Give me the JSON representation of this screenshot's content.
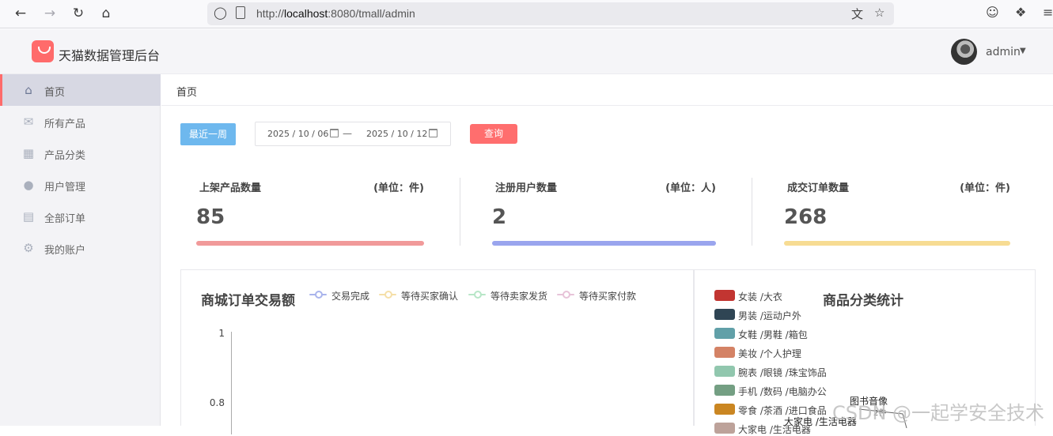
{
  "browser": {
    "url_prefix": "http://",
    "url_host": "localhost",
    "url_path": ":8080/tmall/admin"
  },
  "header": {
    "app_title": "天猫数据管理后台",
    "user_name": "admin"
  },
  "sidebar": {
    "items": [
      {
        "label": "首页",
        "icon": "home-icon",
        "active": true
      },
      {
        "label": "所有产品",
        "icon": "mail-icon",
        "active": false
      },
      {
        "label": "产品分类",
        "icon": "grid-icon",
        "active": false
      },
      {
        "label": "用户管理",
        "icon": "user-icon",
        "active": false
      },
      {
        "label": "全部订单",
        "icon": "clipboard-icon",
        "active": false
      },
      {
        "label": "我的账户",
        "icon": "gear-icon",
        "active": false
      }
    ]
  },
  "breadcrumb": "首页",
  "filters": {
    "week_button": "最近一周",
    "start_date": "2025 / 10 / 06",
    "separator": "—",
    "end_date": "2025 / 10 / 12",
    "query_button": "查询"
  },
  "stats": [
    {
      "label": "上架产品数量",
      "unit": "(单位：件)",
      "value": "85",
      "color": "#f19a9a"
    },
    {
      "label": "注册用户数量",
      "unit": "(单位：人)",
      "value": "2",
      "color": "#9aa5ee"
    },
    {
      "label": "成交订单数量",
      "unit": "(单位：件)",
      "value": "268",
      "color": "#f7dc93"
    }
  ],
  "order_chart": {
    "title": "商城订单交易额",
    "legend": [
      {
        "name": "交易完成",
        "color": "#a9b4ec"
      },
      {
        "name": "等待买家确认",
        "color": "#f5dfa8"
      },
      {
        "name": "等待卖家发货",
        "color": "#b7e6c7"
      },
      {
        "name": "等待买家付款",
        "color": "#e7c3d8"
      }
    ],
    "y_ticks": [
      "1",
      "0.8"
    ]
  },
  "category_chart": {
    "title": "商品分类统计",
    "categories": [
      {
        "name": "女装 /大衣",
        "color": "#c23531"
      },
      {
        "name": "男装 /运动户外",
        "color": "#2f4554"
      },
      {
        "name": "女鞋 /男鞋 /箱包",
        "color": "#61a0a8"
      },
      {
        "name": "美妆 /个人护理",
        "color": "#d48265"
      },
      {
        "name": "腕表 /眼镜 /珠宝饰品",
        "color": "#91c7ae"
      },
      {
        "name": "手机 /数码 /电脑办公",
        "color": "#749f83"
      },
      {
        "name": "零食 /茶酒 /进口食品",
        "color": "#ca8622"
      },
      {
        "name": "大家电 /生活电器",
        "color": "#bda29a"
      }
    ],
    "pie_labels": {
      "label_a": "图书音像",
      "label_a_sub": "2件",
      "label_b": "大家电 /生活电器"
    }
  },
  "watermark": "CSDN @一起学安全技术"
}
